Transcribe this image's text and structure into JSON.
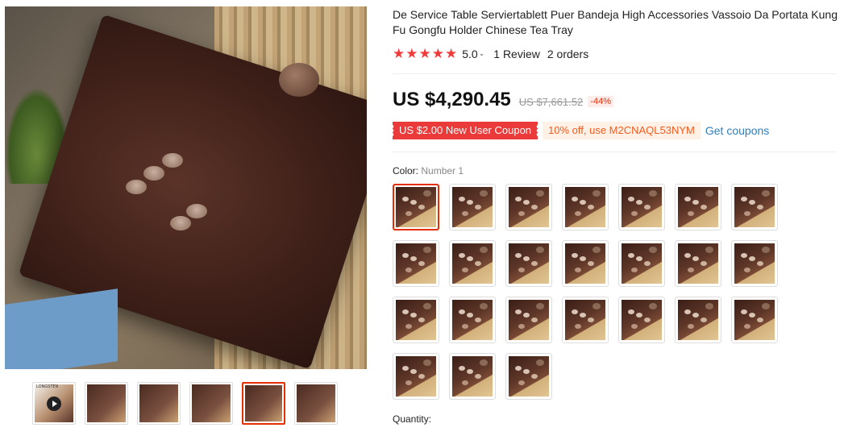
{
  "product": {
    "title": "De Service Table Serviertablett Puer Bandeja High Accessories Vassoio Da Portata Kung Fu Gongfu Holder Chinese Tea Tray"
  },
  "rating": {
    "stars": 5,
    "value": "5.0",
    "caret": "⌄",
    "reviews": "1 Review",
    "orders": "2 orders"
  },
  "price": {
    "current": "US $4,290.45",
    "original": "US $7,661.52",
    "discount": "-44%"
  },
  "coupons": {
    "new_user": "US $2.00 New User Coupon",
    "code_offer": "10% off, use M2CNAQL53NYM",
    "get_link": "Get coupons"
  },
  "color": {
    "label": "Color:",
    "selected_value": "Number 1",
    "swatch_count": 24,
    "selected_index": 0
  },
  "thumbnails": {
    "count": 6,
    "active_index": 4,
    "video_label": "LONGSTEN"
  },
  "quantity": {
    "label": "Quantity:"
  },
  "colors": {
    "accent_red": "#e62e04",
    "star_red": "#f03b3b",
    "link_blue": "#2e80c0",
    "coupon_orange": "#f25c1f"
  }
}
